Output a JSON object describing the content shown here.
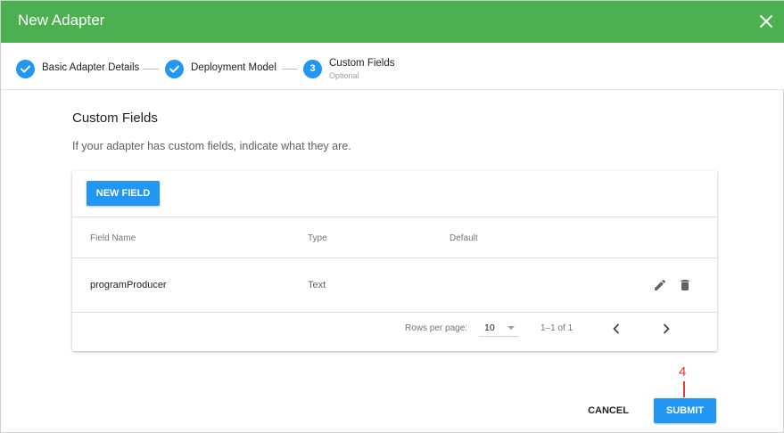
{
  "header": {
    "title": "New Adapter",
    "close_icon": "close-icon"
  },
  "stepper": {
    "steps": [
      {
        "label": "Basic Adapter Details",
        "state": "complete",
        "icon": "check-icon"
      },
      {
        "label": "Deployment Model",
        "state": "complete",
        "icon": "check-icon"
      },
      {
        "label": "Custom Fields",
        "sublabel": "Optional",
        "state": "active",
        "number": "3"
      }
    ]
  },
  "section": {
    "title": "Custom Fields",
    "description": "If your adapter has custom fields, indicate what they are."
  },
  "table": {
    "new_field_label": "NEW FIELD",
    "columns": [
      "Field Name",
      "Type",
      "Default"
    ],
    "rows": [
      {
        "field_name": "programProducer",
        "type": "Text",
        "default": ""
      }
    ],
    "row_actions": [
      "edit-icon",
      "delete-icon"
    ],
    "footer": {
      "rows_per_page_label": "Rows per page:",
      "rows_per_page_value": "10",
      "range": "1–1 of 1"
    }
  },
  "annotation": {
    "number": "4"
  },
  "actions": {
    "cancel_label": "CANCEL",
    "submit_label": "SUBMIT"
  },
  "colors": {
    "header": "#4caf50",
    "accent": "#2196f3",
    "annotation": "#e53935"
  }
}
